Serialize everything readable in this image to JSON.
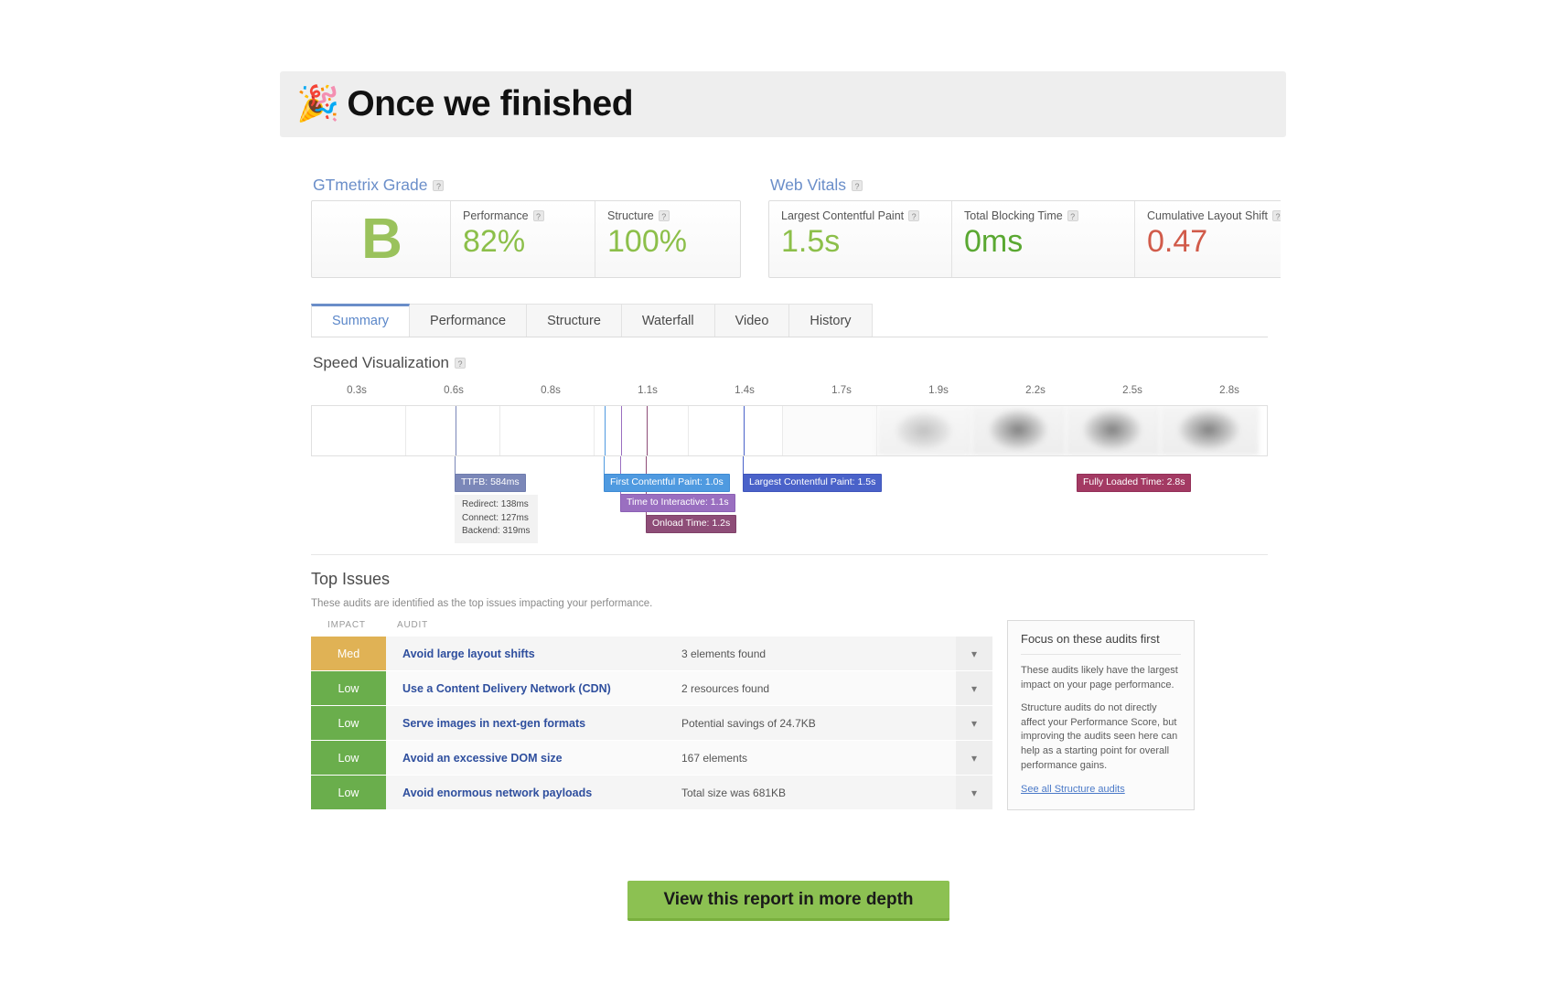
{
  "banner": {
    "emoji": "🎉",
    "emoji_name": "party-popper-emoji",
    "title": "Once we finished"
  },
  "grade": {
    "group_title": "GTmetrix Grade",
    "help": "?",
    "letter": "B",
    "metrics": [
      {
        "label": "Performance",
        "value": "82%",
        "help": "?"
      },
      {
        "label": "Structure",
        "value": "100%",
        "help": "?"
      }
    ]
  },
  "web_vitals": {
    "group_title": "Web Vitals",
    "help": "?",
    "metrics": [
      {
        "label": "Largest Contentful Paint",
        "value": "1.5s",
        "help": "?",
        "status": "good"
      },
      {
        "label": "Total Blocking Time",
        "value": "0ms",
        "help": "?",
        "status": "good"
      },
      {
        "label": "Cumulative Layout Shift",
        "value": "0.47",
        "help": "?",
        "status": "bad"
      }
    ]
  },
  "tabs": [
    {
      "label": "Summary",
      "active": true
    },
    {
      "label": "Performance",
      "active": false
    },
    {
      "label": "Structure",
      "active": false
    },
    {
      "label": "Waterfall",
      "active": false
    },
    {
      "label": "Video",
      "active": false
    },
    {
      "label": "History",
      "active": false
    }
  ],
  "speed_visualization": {
    "title": "Speed Visualization",
    "help": "?",
    "ticks": [
      "0.3s",
      "0.6s",
      "0.8s",
      "1.1s",
      "1.4s",
      "1.7s",
      "1.9s",
      "2.2s",
      "2.5s",
      "2.8s"
    ],
    "markers": [
      {
        "label": "TTFB: 584ms",
        "kind": "ttfb"
      },
      {
        "label": "First Contentful Paint: 1.0s",
        "kind": "fcp"
      },
      {
        "label": "Time to Interactive: 1.1s",
        "kind": "tti"
      },
      {
        "label": "Onload Time: 1.2s",
        "kind": "onload"
      },
      {
        "label": "Largest Contentful Paint: 1.5s",
        "kind": "lcp"
      },
      {
        "label": "Fully Loaded Time: 2.8s",
        "kind": "fully"
      }
    ],
    "ttfb_breakdown": [
      "Redirect: 138ms",
      "Connect: 127ms",
      "Backend: 319ms"
    ]
  },
  "top_issues": {
    "title": "Top Issues",
    "subtitle": "These audits are identified as the top issues impacting your performance.",
    "columns": [
      "IMPACT",
      "AUDIT"
    ],
    "rows": [
      {
        "impact": "Med",
        "impact_level": "med",
        "audit": "Avoid large layout shifts",
        "detail": "3 elements found",
        "chevron": "chevron-down-icon"
      },
      {
        "impact": "Low",
        "impact_level": "low",
        "audit": "Use a Content Delivery Network (CDN)",
        "detail": "2 resources found",
        "chevron": "chevron-down-icon"
      },
      {
        "impact": "Low",
        "impact_level": "low",
        "audit": "Serve images in next-gen formats",
        "detail": "Potential savings of 24.7KB",
        "chevron": "chevron-down-icon"
      },
      {
        "impact": "Low",
        "impact_level": "low",
        "audit": "Avoid an excessive DOM size",
        "detail": "167 elements",
        "chevron": "chevron-down-icon"
      },
      {
        "impact": "Low",
        "impact_level": "low",
        "audit": "Avoid enormous network payloads",
        "detail": "Total size was 681KB",
        "chevron": "chevron-down-icon"
      }
    ]
  },
  "focus_panel": {
    "title": "Focus on these audits first",
    "paragraph1": "These audits likely have the largest impact on your page performance.",
    "paragraph2": "Structure audits do not directly affect your Performance Score, but improving the audits seen here can help as a starting point for overall performance gains.",
    "link": "See all Structure audits"
  },
  "cta": {
    "label": "View this report in more depth"
  },
  "colors": {
    "accent_blue": "#6a8ec9",
    "grade_green": "#9ac25c",
    "good_green": "#8cbf4a",
    "bad_red": "#d15b4a",
    "impact_med": "#e0b255",
    "impact_low": "#6aae4c",
    "cta_green": "#8cc152",
    "banner_bg": "#eeeeee"
  }
}
